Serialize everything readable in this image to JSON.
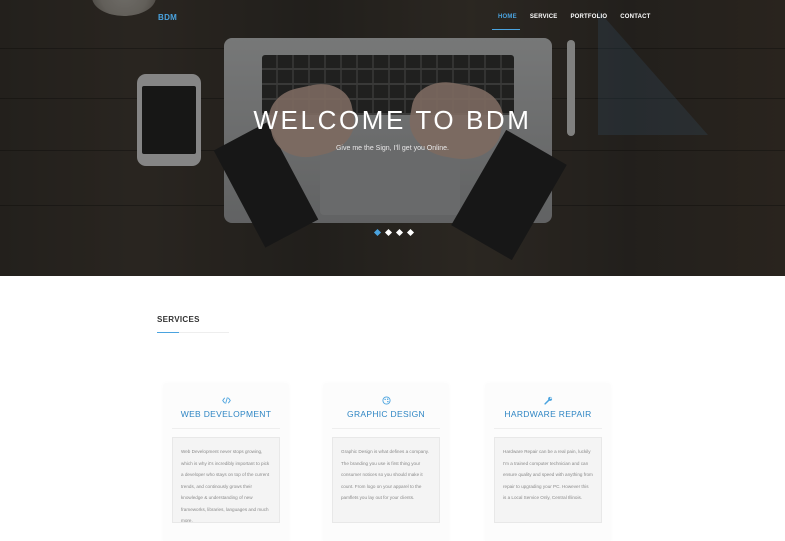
{
  "header": {
    "brand": "BDM",
    "nav": [
      {
        "label": "HOME",
        "active": true
      },
      {
        "label": "SERVICE",
        "active": false
      },
      {
        "label": "PORTFOLIO",
        "active": false
      },
      {
        "label": "CONTACT",
        "active": false
      }
    ]
  },
  "hero": {
    "title": "WELCOME TO BDM",
    "subtitle": "Give me the Sign, I'll get you Online.",
    "slides": 4,
    "active_slide": 1
  },
  "services": {
    "title": "SERVICES",
    "cards": [
      {
        "icon": "code-icon",
        "title": "WEB DEVELOPMENT",
        "text": "Web Development never stops growing, which is why it's incredibly important to pick a developer who stays on top of the current trends, and continously grows their knowledge & understanding of new frameworks, libraries, languages and much more."
      },
      {
        "icon": "palette-icon",
        "title": "GRAPHIC DESIGN",
        "text": "Graphic Design is what defines a company. The branding you use is first thing your consumer notices so you should make it count. From logo on your apparel to the pamflets you lay out for your clients."
      },
      {
        "icon": "wrench-icon",
        "title": "HARDWARE REPAIR",
        "text": "Hardware Repair can be a real pain, luckily I'm a trained computer technician and can ensure quality and speed with anything from repair to upgrading your PC. However this is a Local Service Only, Central Illinois."
      }
    ]
  },
  "colors": {
    "accent": "#4aa3df",
    "card_title": "#2f86c4"
  }
}
